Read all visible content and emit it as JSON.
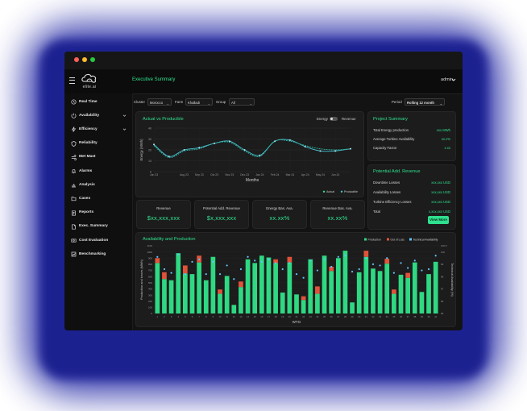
{
  "app": {
    "logo_text": "elite.ai",
    "page_title": "Executive Summary",
    "user": "admin"
  },
  "colors": {
    "accent": "#2fe08e",
    "production": "#2fd882",
    "out_of_loss": "#e0533a",
    "availability": "#5fc6ff",
    "line": "#47c4d6"
  },
  "sidebar": {
    "items": [
      {
        "label": "Real Time",
        "icon": "clock-icon",
        "chevron": false
      },
      {
        "label": "Availability",
        "icon": "power-icon",
        "chevron": true
      },
      {
        "label": "Efficiency",
        "icon": "lightning-icon",
        "chevron": true
      },
      {
        "label": "Reliability",
        "icon": "shield-icon",
        "chevron": false
      },
      {
        "label": "Met Mast",
        "icon": "wind-icon",
        "chevron": false
      },
      {
        "label": "Alarms",
        "icon": "bell-icon",
        "chevron": false
      },
      {
        "label": "Analysis",
        "icon": "chart-icon",
        "chevron": false
      },
      {
        "label": "Cases",
        "icon": "folder-icon",
        "chevron": false
      },
      {
        "label": "Reports",
        "icon": "report-icon",
        "chevron": false
      },
      {
        "label": "Exec. Summary",
        "icon": "document-icon",
        "chevron": false
      },
      {
        "label": "Cost Evaluation",
        "icon": "money-icon",
        "chevron": false
      },
      {
        "label": "Benchmarking",
        "icon": "benchmark-icon",
        "chevron": false
      }
    ]
  },
  "filters": {
    "cluster_label": "Cluster",
    "cluster_value": "Morocco",
    "farm_label": "Farm",
    "farm_value": "Khalladi",
    "group_label": "Group",
    "group_value": "All",
    "period_label": "Period",
    "period_value": "Rolling 12 month"
  },
  "actual_vs_producible": {
    "title": "Actual vs Producible",
    "toggle_left": "Energy",
    "toggle_right": "Revenue",
    "legend_actual": "Actual",
    "legend_producible": "Producible"
  },
  "kpis": [
    {
      "label": "Revenue",
      "value": "$xx,xxx,xxx"
    },
    {
      "label": "Potential Add. Revenue",
      "value": "$x,xxx,xxx"
    },
    {
      "label": "Energy Bas. Ava.",
      "value": "xx.xx%"
    },
    {
      "label": "Revenue Bas. Ava.",
      "value": "xx.xx%"
    }
  ],
  "project_summary": {
    "title": "Project Summary",
    "rows": [
      {
        "label": "Total Energy production",
        "value": "xxx MWh"
      },
      {
        "label": "Average Turbine Availability",
        "value": "xx.x%"
      },
      {
        "label": "Capacity Factor",
        "value": "x.xx"
      }
    ]
  },
  "potential_revenue": {
    "title": "Potential Add. Revenue",
    "rows": [
      {
        "label": "Downtime Losses",
        "value": "xxx,xxx USD"
      },
      {
        "label": "Availability Losses",
        "value": "xxx,xxx USD"
      },
      {
        "label": "Turbine Efficiency Losses",
        "value": "xxx,xxx USD"
      },
      {
        "label": "Total",
        "value": "x,xxx,xxx USD"
      }
    ],
    "button": "View More"
  },
  "availability_production": {
    "title": "Availability and Production",
    "legend": {
      "production": "Production",
      "out_of_loss": "Out of Loss",
      "availability": "Technical Availability"
    }
  },
  "chart_data": [
    {
      "type": "line",
      "title": "Actual vs Producible",
      "xlabel": "Months",
      "ylabel": "Energy (MWh)",
      "x": [
        "Jun 23",
        "Jul 23",
        "Aug 23",
        "Sep 23",
        "Oct 23",
        "Nov 23",
        "Dec 23",
        "Jan 24",
        "Feb 24",
        "Mar 24",
        "Apr 24",
        "May 24",
        "Jun 24",
        "Jul 24"
      ],
      "x_ticks": [
        "Jun 23",
        "Aug 23",
        "Sep 23",
        "Oct 23",
        "Nov 23",
        "Dec 23",
        "Jan 24",
        "Feb 24",
        "Mar 24",
        "Apr 24",
        "May 24",
        "Jun 24"
      ],
      "ylim": [
        0,
        40
      ],
      "y_ticks": [
        0,
        10,
        20,
        30,
        40
      ],
      "series": [
        {
          "name": "Actual",
          "values": [
            25,
            14,
            20,
            22,
            26,
            28,
            20,
            15,
            28,
            29,
            23,
            19,
            19,
            21
          ]
        },
        {
          "name": "Producible",
          "values": [
            24,
            13,
            19,
            21,
            26,
            27,
            19,
            14,
            28,
            28,
            24,
            21,
            20,
            21
          ]
        }
      ]
    },
    {
      "type": "bar",
      "title": "Availability and Production",
      "xlabel": "WTG",
      "ylabel": "Production and losses (MWh)",
      "y2label": "Technical Availability (%)",
      "categories": [
        "1",
        "2",
        "3",
        "4",
        "5",
        "6",
        "7",
        "8",
        "9",
        "10",
        "11",
        "12",
        "13",
        "14",
        "15",
        "16",
        "17",
        "18",
        "19",
        "20",
        "21",
        "22",
        "23",
        "24",
        "25",
        "26",
        "27",
        "28",
        "29",
        "30",
        "31",
        "32",
        "33",
        "34",
        "35",
        "36",
        "37",
        "38",
        "39",
        "40",
        "41"
      ],
      "ylim": [
        0,
        1100
      ],
      "y_ticks": [
        "0",
        "100",
        "200",
        "300",
        "400",
        "500",
        "600",
        "700",
        "800",
        "900",
        "1000",
        "1100"
      ],
      "y2lim": [
        95,
        100.5
      ],
      "y2_ticks": [
        "95",
        "96",
        "97",
        "98",
        "99",
        "100",
        "100.5"
      ],
      "series": [
        {
          "name": "Production",
          "values": [
            820,
            560,
            540,
            980,
            650,
            640,
            830,
            540,
            920,
            320,
            610,
            140,
            430,
            880,
            820,
            940,
            910,
            820,
            340,
            830,
            310,
            220,
            880,
            320,
            940,
            690,
            900,
            1020,
            180,
            670,
            920,
            730,
            690,
            810,
            320,
            630,
            580,
            830,
            350,
            640,
            840
          ]
        },
        {
          "name": "Out of Loss",
          "values": [
            80,
            110,
            0,
            0,
            130,
            0,
            110,
            0,
            0,
            70,
            0,
            0,
            90,
            0,
            0,
            0,
            0,
            60,
            0,
            90,
            0,
            60,
            0,
            120,
            0,
            70,
            0,
            0,
            0,
            0,
            100,
            0,
            0,
            80,
            70,
            0,
            80,
            0,
            0,
            0,
            0
          ]
        },
        {
          "name": "Technical Availability",
          "values": [
            99.6,
            98.6,
            98.3,
            99.8,
            98.2,
            99.2,
            99.4,
            98.2,
            99.2,
            98.2,
            98.9,
            97.8,
            98.6,
            99.6,
            99.3,
            99.2,
            99.4,
            99.1,
            98.6,
            99.1,
            98.2,
            97.9,
            99.3,
            98.5,
            99.4,
            98.8,
            99.6,
            99.7,
            98.4,
            98.6,
            99.5,
            99.0,
            98.9,
            99.5,
            98.3,
            99.1,
            98.7,
            99.3,
            98.5,
            98.6,
            99.7
          ]
        }
      ]
    }
  ]
}
